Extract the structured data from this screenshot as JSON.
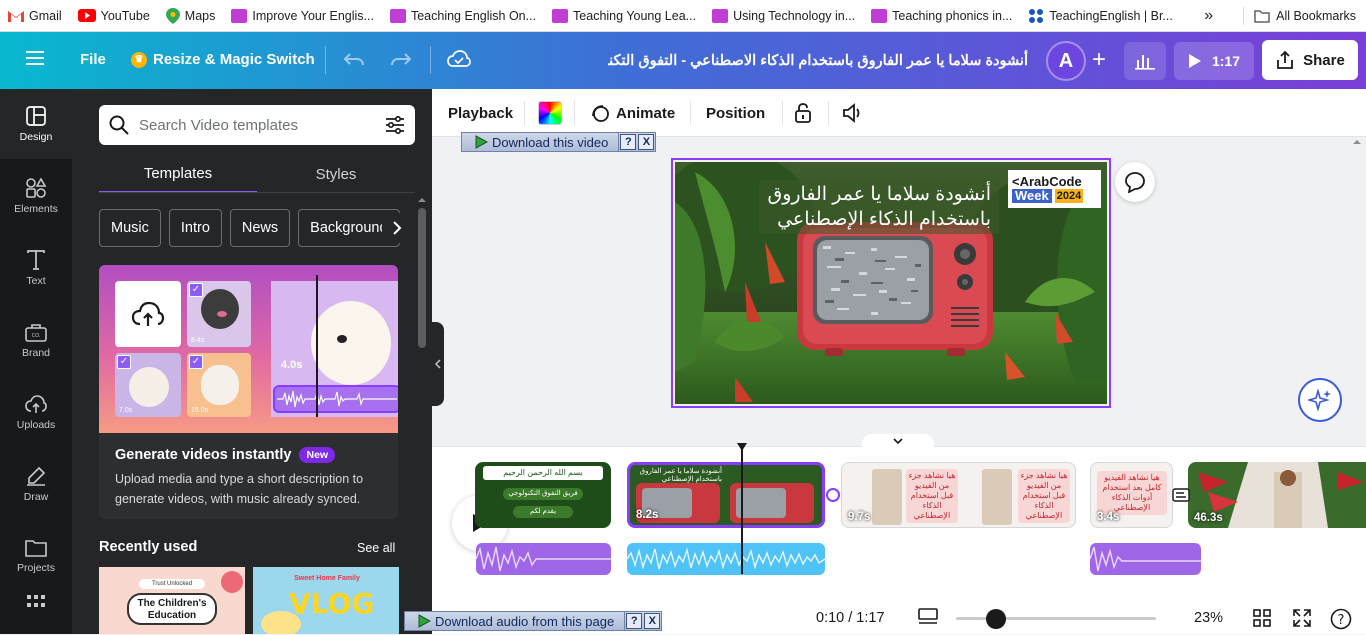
{
  "bookmarks": {
    "items": [
      {
        "label": "Gmail",
        "color": "#ea4335"
      },
      {
        "label": "YouTube",
        "color": "#ff0000"
      },
      {
        "label": "Maps",
        "color": "#34a853"
      },
      {
        "label": "Improve Your Englis...",
        "color": "#c13dd6"
      },
      {
        "label": "Teaching English On...",
        "color": "#c13dd6"
      },
      {
        "label": "Teaching Young Lea...",
        "color": "#c13dd6"
      },
      {
        "label": "Using Technology in...",
        "color": "#c13dd6"
      },
      {
        "label": "Teaching phonics in...",
        "color": "#c13dd6"
      },
      {
        "label": "TeachingEnglish | Br...",
        "color": "#1a55c4"
      }
    ],
    "more": "»",
    "all_bookmarks": "All Bookmarks"
  },
  "header": {
    "file": "File",
    "resize": "Resize & Magic Switch",
    "title": "أنشودة سلاما يا عمر الفاروق باستخدام الذكاء الاصطناعي - التفوق التكنولوجي ...",
    "avatar_letter": "A",
    "duration": "1:17",
    "share": "Share"
  },
  "rail": {
    "items": [
      {
        "label": "Design",
        "icon": "design-icon"
      },
      {
        "label": "Elements",
        "icon": "elements-icon"
      },
      {
        "label": "Text",
        "icon": "text-icon"
      },
      {
        "label": "Brand",
        "icon": "brand-icon"
      },
      {
        "label": "Uploads",
        "icon": "uploads-icon"
      },
      {
        "label": "Draw",
        "icon": "draw-icon"
      },
      {
        "label": "Projects",
        "icon": "projects-icon"
      },
      {
        "label": "",
        "icon": "apps-icon"
      }
    ]
  },
  "panel": {
    "search_placeholder": "Search Video templates",
    "tabs": [
      "Templates",
      "Styles"
    ],
    "chips": [
      "Music",
      "Intro",
      "News",
      "Background"
    ],
    "promo": {
      "title": "Generate videos instantly",
      "badge": "New",
      "desc": "Upload media and type a short description to generate videos, with music already synced.",
      "durations": [
        "8.4s",
        "4.0s",
        "7.0s",
        "15.0s"
      ]
    },
    "recent_title": "Recently used",
    "see_all": "See all",
    "thumb1_text": "The Children's Education",
    "thumb1_small": "Trust Unlocked",
    "thumb2_text": "VLOG",
    "thumb2_small": "Sweet Home Family"
  },
  "toolbar": {
    "playback": "Playback",
    "animate": "Animate",
    "position": "Position"
  },
  "overlays": {
    "download_video": "Download this video",
    "download_audio": "Download audio from this page",
    "help": "?",
    "close": "X"
  },
  "canvas": {
    "line1": "أنشودة سلاما يا عمر الفاروق",
    "line2": "باستخدام الذكاء الإصطناعي",
    "logo_line1": "ArabCode",
    "logo_line2": "Week",
    "logo_year": "2024"
  },
  "timeline": {
    "clips": [
      {
        "duration": "",
        "text": "بسم الله الرحمن الرحيم",
        "sub": "فريق التفوق التكنولوجي",
        "sub2": "يقدم لكم"
      },
      {
        "duration": "8.2s",
        "text": "أنشودة سلاما يا عمر الفاروق باستخدام الإصطناعي"
      },
      {
        "duration": "9.7s",
        "text": "هيا نشاهد جزء من الفيديو قبل استخدام الذكاء الإصطناعي"
      },
      {
        "duration": "3.4s",
        "text": "هيا نشاهد الفيديو كامل بعد استخدام أدوات الذكاء الإصطناعي"
      },
      {
        "duration": "46.3s",
        "text": ""
      }
    ],
    "time": "0:10 / 1:17",
    "zoom": "23%",
    "zoom_level": 0.2
  },
  "colors": {
    "accent": "#8b3dff",
    "rail_bg": "#18191b",
    "panel_bg": "#252627",
    "wave_purple": "#a066e8",
    "wave_blue": "#4fc3f7"
  }
}
